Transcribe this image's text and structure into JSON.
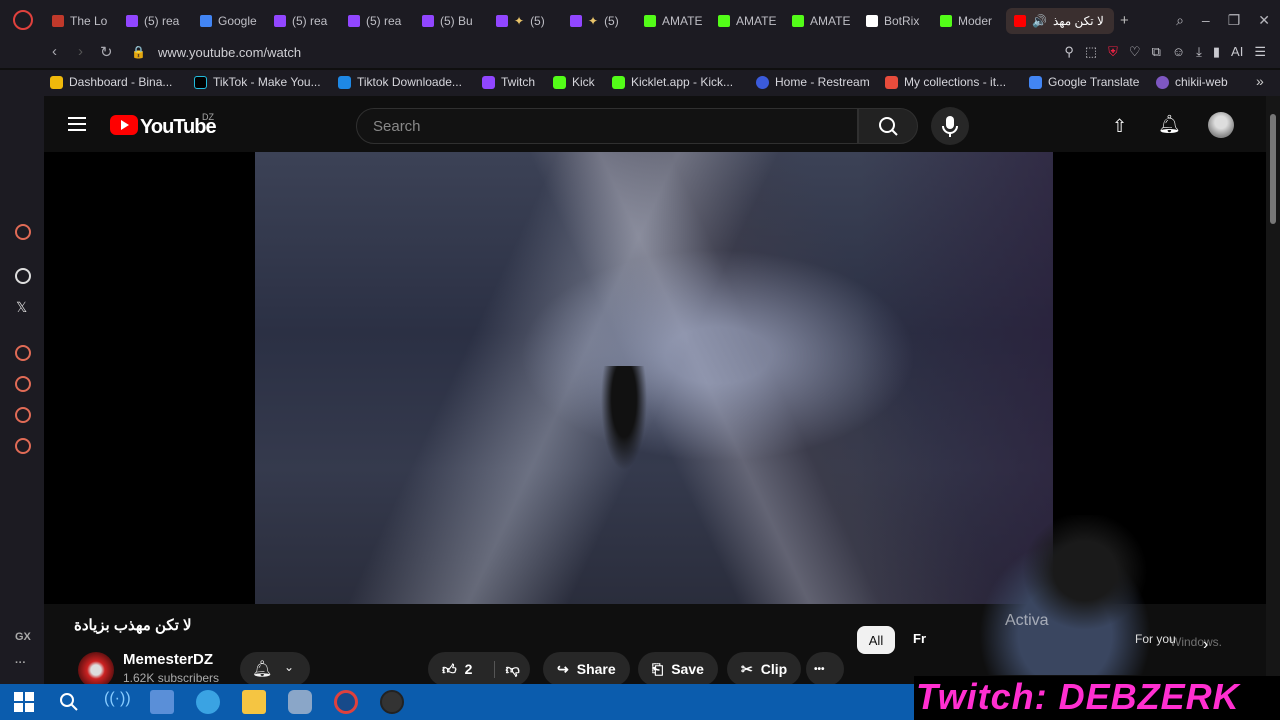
{
  "browser": {
    "tabs": [
      {
        "label": "The Lo",
        "color": "#c0392b"
      },
      {
        "label": "(5) rea",
        "color": "#9146ff"
      },
      {
        "label": "Google",
        "color": "#4285f4"
      },
      {
        "label": "(5) rea",
        "color": "#9146ff"
      },
      {
        "label": "(5) rea",
        "color": "#9146ff"
      },
      {
        "label": "(5) Bu",
        "color": "#9146ff"
      },
      {
        "label": "(5)",
        "color": "#9146ff"
      },
      {
        "label": "(5)",
        "color": "#9146ff"
      },
      {
        "label": "AMATE",
        "color": "#53fc18"
      },
      {
        "label": "AMATE",
        "color": "#53fc18"
      },
      {
        "label": "AMATE",
        "color": "#53fc18"
      },
      {
        "label": "BotRix",
        "color": "#ffffff"
      },
      {
        "label": "Moder",
        "color": "#53fc18"
      },
      {
        "label": "لا تكن مهذ",
        "color": "#ff0000"
      }
    ],
    "url": "www.youtube.com/watch",
    "ai_label": "AI",
    "bookmarks": [
      {
        "label": "Dashboard - Bina...",
        "color": "#f0b90b"
      },
      {
        "label": "TikTok - Make You...",
        "color": "#000000"
      },
      {
        "label": "Tiktok Downloade...",
        "color": "#1e88e5"
      },
      {
        "label": "Twitch",
        "color": "#9146ff"
      },
      {
        "label": "Kick",
        "color": "#53fc18"
      },
      {
        "label": "Kicklet.app - Kick...",
        "color": "#53fc18"
      },
      {
        "label": "Home - Restream",
        "color": "#3b5bdb"
      },
      {
        "label": "My collections - it...",
        "color": "#e74c3c"
      },
      {
        "label": "Google Translate",
        "color": "#4285f4"
      },
      {
        "label": "chikii-web",
        "color": "#7e57c2"
      }
    ],
    "sidebar_gx": "GX"
  },
  "youtube": {
    "logo_text": "YouTube",
    "country": "DZ",
    "search_placeholder": "Search",
    "video_title": "لا تكن مهذب بزيادة",
    "channel_name": "MemesterDZ",
    "channel_subs": "1.62K subscribers",
    "like_count": "2",
    "share_label": "Share",
    "save_label": "Save",
    "clip_label": "Clip",
    "more_label": "•••",
    "chip_all": "All",
    "chip_fr": "Fr",
    "chip_foryou": "For you"
  },
  "overlay": {
    "activate_text": "Activa",
    "activate_sub": "Windows.",
    "twitch_banner": "Twitch: DEBZERK"
  },
  "colors": {
    "youtube_red": "#ff0000",
    "twitch_pink": "#ff2fd0",
    "taskbar_blue": "#0b5cad"
  }
}
